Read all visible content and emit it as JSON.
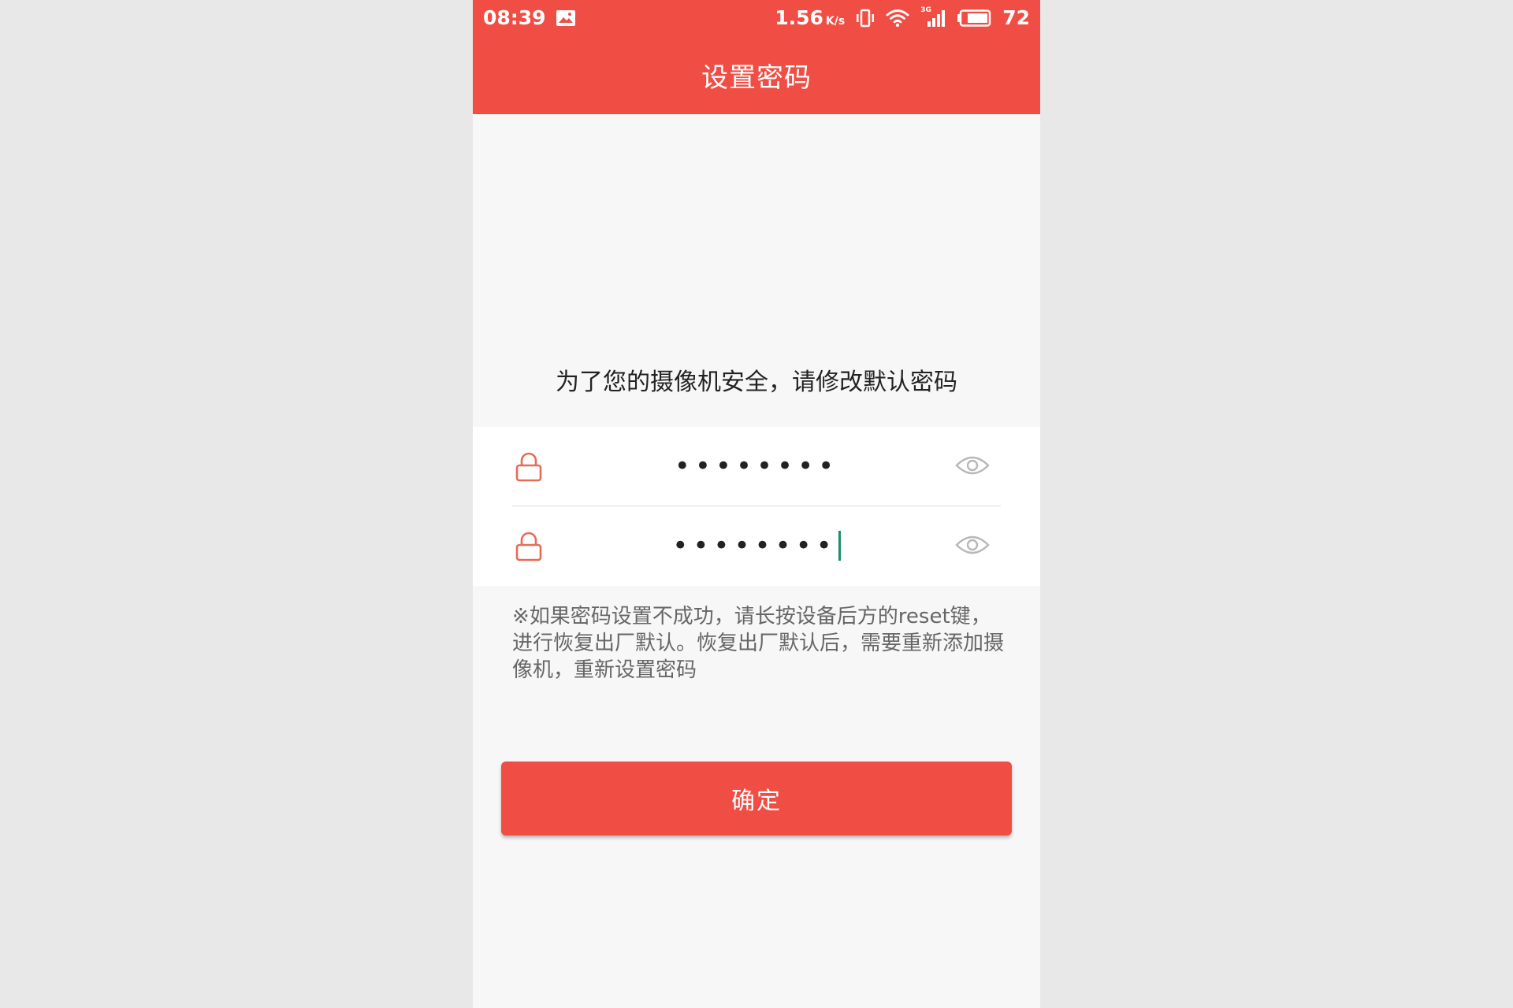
{
  "colors": {
    "accent": "#f04e44",
    "outer_background": "#e8e8e8",
    "content_background": "#f7f7f7",
    "caret": "#1a8f6b"
  },
  "status_bar": {
    "time": "08:39",
    "net_speed": "1.56",
    "net_speed_unit": "K/s",
    "network_type": "3G",
    "battery": "72",
    "icons": [
      "image-notification-icon",
      "vibrate-icon",
      "wifi-icon",
      "signal-icon",
      "battery-icon"
    ]
  },
  "app_bar": {
    "title": "设置密码"
  },
  "prompt": "为了您的摄像机安全，请修改默认密码",
  "fields": [
    {
      "value_masked": "••••••••",
      "focused": false,
      "icons": [
        "lock-icon",
        "eye-icon"
      ]
    },
    {
      "value_masked": "••••••••",
      "focused": true,
      "icons": [
        "lock-icon",
        "eye-icon"
      ]
    }
  ],
  "note": "※如果密码设置不成功，请长按设备后方的reset键，进行恢复出厂默认。恢复出厂默认后，需要重新添加摄像机，重新设置密码",
  "confirm_button": {
    "label": "确定"
  }
}
